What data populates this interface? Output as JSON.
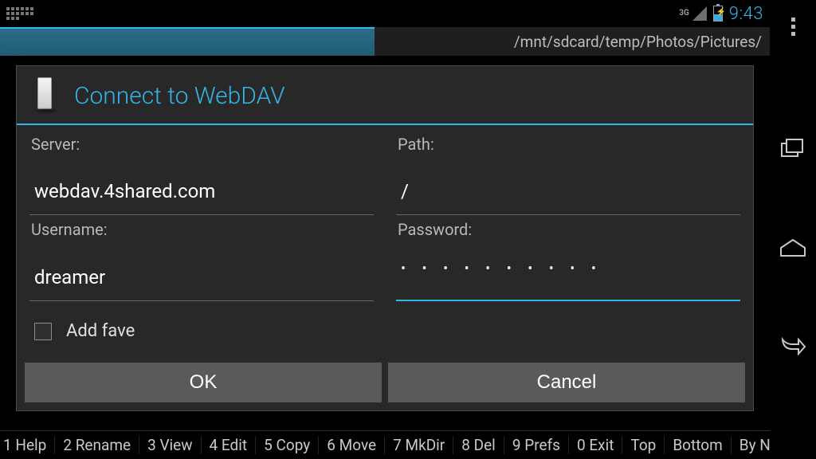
{
  "status": {
    "network": "3G",
    "clock": "9:43"
  },
  "header": {
    "breadcrumb": "/mnt/sdcard/temp/Photos/Pictures/"
  },
  "dialog": {
    "title": "Connect to WebDAV",
    "labels": {
      "server": "Server:",
      "path": "Path:",
      "username": "Username:",
      "password": "Password:",
      "add_fave": "Add fave"
    },
    "values": {
      "server": "webdav.4shared.com",
      "path": "/",
      "username": "dreamer",
      "password_mask": "• • • • • • • • • •"
    },
    "buttons": {
      "ok": "OK",
      "cancel": "Cancel"
    }
  },
  "toolbar": {
    "items": [
      "1 Help",
      "2 Rename",
      "3 View",
      "4 Edit",
      "5 Copy",
      "6 Move",
      "7 MkDir",
      "8 Del",
      "9 Prefs",
      "0 Exit",
      "Top",
      "Bottom",
      "By N"
    ]
  }
}
